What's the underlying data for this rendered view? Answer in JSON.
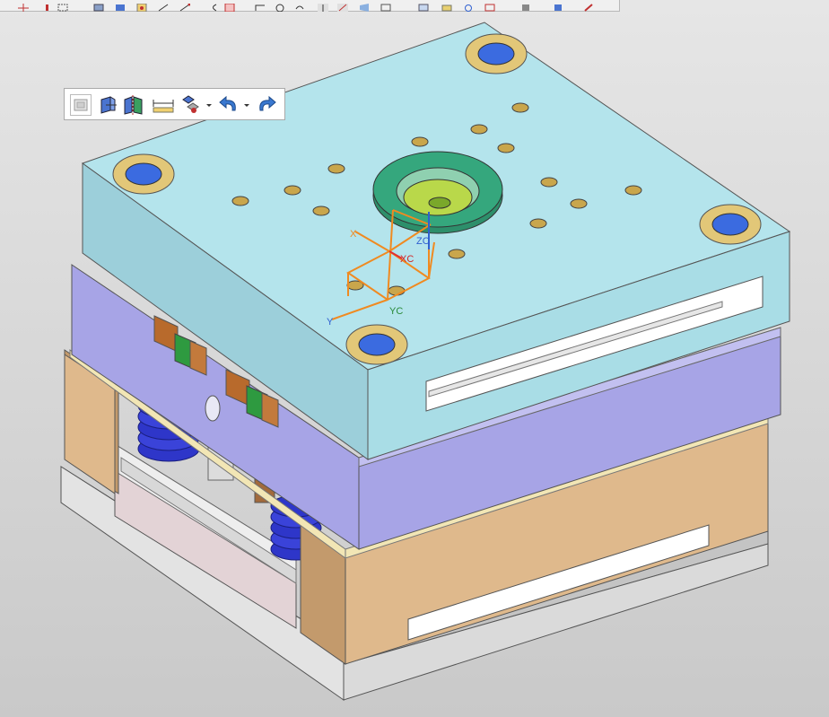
{
  "colors": {
    "background_top": "#e6e6e6",
    "background_bottom": "#c9c9c9",
    "top_clamp_plate": "#a9dde6",
    "a_plate": "#a7a4e6",
    "b_plate": "#dfb98c",
    "ejector_plate": "#e3d3d6",
    "bottom_clamp_plate": "#e3e3e3",
    "locating_ring": "#35a77d",
    "sprue_bushing": "#b9d84a",
    "guide_bushing_blue": "#3b6be0",
    "guide_bushing_ring": "#e2c778",
    "spring": "#2e36c9",
    "csys": "#f08a20"
  },
  "coordinate_system": {
    "labels": {
      "x": "X",
      "y": "Y",
      "xc": "XC",
      "yc": "YC",
      "zc": "ZC"
    }
  },
  "top_toolbar": {
    "icons": [
      "csys-icon",
      "point-icon",
      "frame-icon",
      "box-icon",
      "solid-icon",
      "render-mode-icon",
      "line-icon",
      "curve-icon",
      "arc-icon",
      "edit-icon",
      "fillet-icon",
      "clock-icon",
      "undo-curve-icon",
      "arrow-up-icon",
      "arrow-diag-icon",
      "view-icon",
      "layer-icon",
      "grid-icon",
      "print-icon",
      "refresh-icon",
      "image-icon",
      "cube-gray-icon",
      "cube-blue-icon",
      "pen-icon"
    ]
  },
  "floating_toolbar": {
    "icons": [
      "snap-icon",
      "extrude-icon",
      "mirror-icon",
      "measure-icon",
      "assembly-icon",
      "dropdown-icon",
      "undo-icon",
      "dropdown-icon-2",
      "redo-icon"
    ]
  }
}
